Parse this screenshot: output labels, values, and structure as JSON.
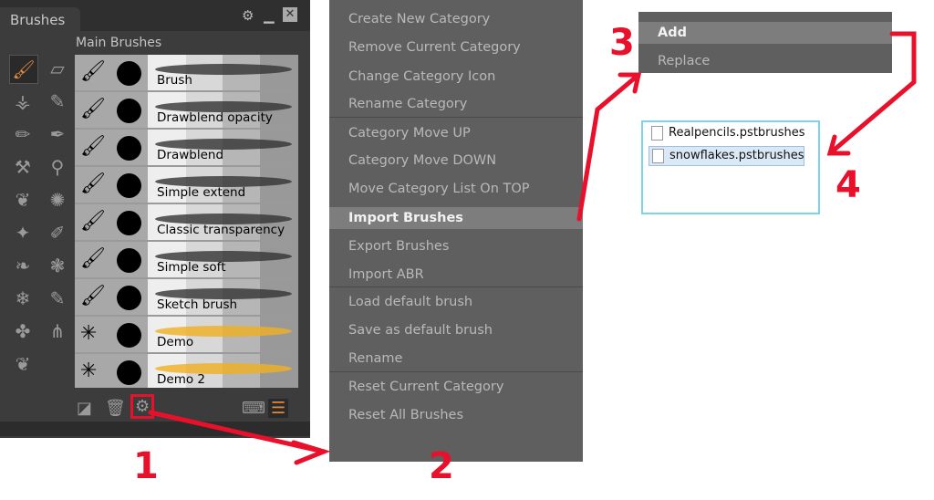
{
  "panel": {
    "title": "Brushes",
    "category": "Main Brushes",
    "brushes": [
      {
        "name": "Brush"
      },
      {
        "name": "Drawblend opacity"
      },
      {
        "name": "Drawblend"
      },
      {
        "name": "Simple extend"
      },
      {
        "name": "Classic transparency"
      },
      {
        "name": "Simple soft"
      },
      {
        "name": "Sketch brush"
      },
      {
        "name": "Demo"
      },
      {
        "name": "Demo 2"
      }
    ]
  },
  "menu": {
    "items": [
      "Create New Category",
      "Remove Current Category",
      "Change Category Icon",
      "Rename Category",
      "Category Move UP",
      "Category Move DOWN",
      "Move Category List On TOP",
      "Import Brushes",
      "Export Brushes",
      "Import ABR",
      "Load default brush",
      "Save as default brush",
      "Rename",
      "Reset Current Category",
      "Reset All Brushes"
    ],
    "highlighted": "Import Brushes"
  },
  "submenu": {
    "items": [
      "Add",
      "Replace"
    ]
  },
  "files": [
    "Realpencils.pstbrushes",
    "snowflakes.pstbrushes"
  ],
  "annotations": [
    "1",
    "2",
    "3",
    "4"
  ],
  "colors": {
    "accent": "#e8102a",
    "highlight": "#7d7d7d"
  }
}
